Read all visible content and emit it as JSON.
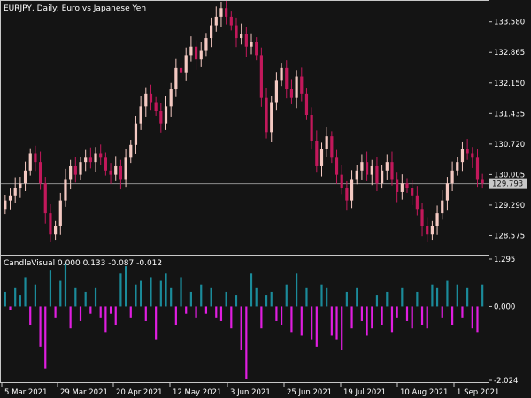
{
  "header": {
    "symbol_info": "EURJPY, Daily:  Euro vs Japanese Yen"
  },
  "indicator": {
    "label": "CandleVisual 0.000 0.133 -0.087 -0.012"
  },
  "colors": {
    "background": "#141414",
    "frame": "#c8c8c8",
    "bull_candle": "#f4c9c2",
    "bear_candle": "#c2185b",
    "histogram_positive": "#1b8b9a",
    "histogram_negative": "#e01ee0",
    "current_price_line": "#8c8c8c",
    "current_price_box": "#c8c8c8"
  },
  "chart_data": [
    {
      "type": "candlestick",
      "name": "EURJPY Daily",
      "price_axis_ticks": [
        "133.580",
        "132.865",
        "132.150",
        "131.435",
        "130.720",
        "130.005",
        "129.290",
        "128.575"
      ],
      "price_axis_values": [
        133.58,
        132.865,
        132.15,
        131.435,
        130.72,
        130.005,
        129.29,
        128.575
      ],
      "ylim": [
        128.15,
        134.05
      ],
      "current_price": "129.793",
      "current_price_value": 129.793,
      "x_tick_labels": [
        "5 Mar 2021",
        "29 Mar 2021",
        "20 Apr 2021",
        "12 May 2021",
        "3 Jun 2021",
        "25 Jun 2021",
        "19 Jul 2021",
        "10 Aug 2021",
        "1 Sep 2021"
      ],
      "closes": [
        129.4,
        129.5,
        129.7,
        129.8,
        130.1,
        130.5,
        130.3,
        129.8,
        129.1,
        128.6,
        128.8,
        129.4,
        129.9,
        130.2,
        130.0,
        130.3,
        130.4,
        130.3,
        130.5,
        130.4,
        130.1,
        130.0,
        130.2,
        129.9,
        130.4,
        130.7,
        131.2,
        131.6,
        131.9,
        131.7,
        131.5,
        131.2,
        131.6,
        132.0,
        132.5,
        132.4,
        132.8,
        133.0,
        132.7,
        132.9,
        133.2,
        133.5,
        133.7,
        133.9,
        133.7,
        133.5,
        133.2,
        133.3,
        133.0,
        133.1,
        132.8,
        131.8,
        131.0,
        131.7,
        132.2,
        132.5,
        132.0,
        131.8,
        132.3,
        131.9,
        131.4,
        130.8,
        130.2,
        130.6,
        130.9,
        130.4,
        130.0,
        129.7,
        129.4,
        129.9,
        130.1,
        130.3,
        130.0,
        130.2,
        129.8,
        130.1,
        130.3,
        129.9,
        129.6,
        129.8,
        129.7,
        129.5,
        129.2,
        128.8,
        128.6,
        128.8,
        129.1,
        129.4,
        129.8,
        130.1,
        130.3,
        130.6,
        130.5,
        130.4,
        129.9,
        129.8
      ],
      "histogram_axis_ticks": [
        "1.295",
        "0.000",
        "-2.024"
      ],
      "histogram_values": [
        0.4,
        -0.1,
        0.5,
        0.3,
        0.8,
        -0.5,
        0.6,
        -1.1,
        -1.7,
        1.0,
        -0.3,
        0.7,
        1.2,
        -0.6,
        0.5,
        -0.4,
        0.4,
        -0.2,
        0.5,
        -0.3,
        -0.7,
        -0.2,
        -0.5,
        0.9,
        1.1,
        -0.3,
        0.6,
        0.7,
        -0.4,
        0.8,
        -0.9,
        0.7,
        0.9,
        0.5,
        -0.5,
        0.8,
        -0.2,
        0.4,
        -0.3,
        0.6,
        -0.2,
        0.5,
        -0.3,
        -0.4,
        0.4,
        -0.6,
        0.3,
        -1.2,
        -2.0,
        0.9,
        0.5,
        -0.6,
        0.3,
        0.4,
        -0.4,
        -0.5,
        0.6,
        -0.7,
        0.9,
        -0.8,
        0.5,
        -0.9,
        -1.1,
        0.6,
        0.5,
        -0.8,
        -0.9,
        -1.2,
        0.4,
        -0.6,
        0.5,
        -0.4,
        -0.8,
        -0.6,
        0.3,
        -0.5,
        0.4,
        -0.7,
        -0.3,
        0.5,
        -0.4,
        -0.6,
        0.4,
        -0.5,
        -0.6,
        0.6,
        0.5,
        -0.3,
        0.7,
        -0.5,
        0.6,
        -0.3,
        0.5,
        -0.6,
        -0.7,
        0.6
      ]
    }
  ]
}
